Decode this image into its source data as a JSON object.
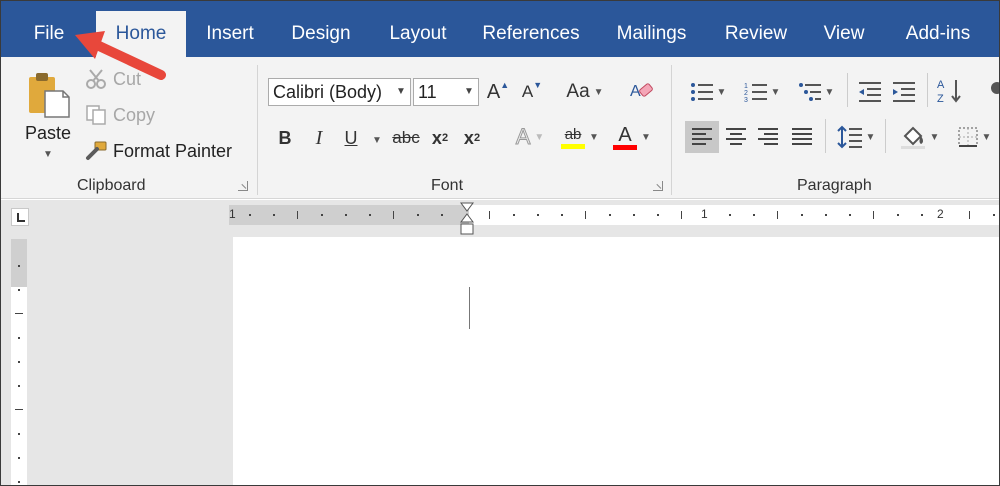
{
  "tabs": [
    "File",
    "Home",
    "Insert",
    "Design",
    "Layout",
    "References",
    "Mailings",
    "Review",
    "View",
    "Add-ins"
  ],
  "active_tab": "Home",
  "clipboard": {
    "group_label": "Clipboard",
    "paste_label": "Paste",
    "cut_label": "Cut",
    "copy_label": "Copy",
    "format_painter_label": "Format Painter"
  },
  "font": {
    "group_label": "Font",
    "font_name": "Calibri (Body)",
    "font_size": "11",
    "grow_label": "A",
    "shrink_label": "A",
    "case_label": "Aa",
    "bold_label": "B",
    "italic_label": "I",
    "underline_label": "U",
    "strike_label": "abc",
    "subscript_label": "x",
    "subscript_sub": "2",
    "superscript_label": "x",
    "superscript_sup": "2",
    "effects_label": "A",
    "highlight_label": "ab",
    "color_label": "A",
    "highlight_color": "#ffff00",
    "font_color": "#ff0000"
  },
  "paragraph": {
    "group_label": "Paragraph"
  },
  "ruler": {
    "numbers": [
      "1",
      "1",
      "2"
    ]
  },
  "colors": {
    "tab_bar": "#2b579a",
    "ribbon": "#f3f3f3",
    "annotation_arrow": "#e8473b"
  },
  "icons": [
    "paste-icon",
    "cut-icon",
    "copy-icon",
    "format-painter-icon",
    "clear-formatting-icon",
    "bullets-icon",
    "numbering-icon",
    "multilevel-list-icon",
    "decrease-indent-icon",
    "increase-indent-icon",
    "sort-icon",
    "show-formatting-icon",
    "align-left-icon",
    "center-icon",
    "align-right-icon",
    "justify-icon",
    "line-spacing-icon",
    "shading-icon",
    "borders-icon"
  ]
}
